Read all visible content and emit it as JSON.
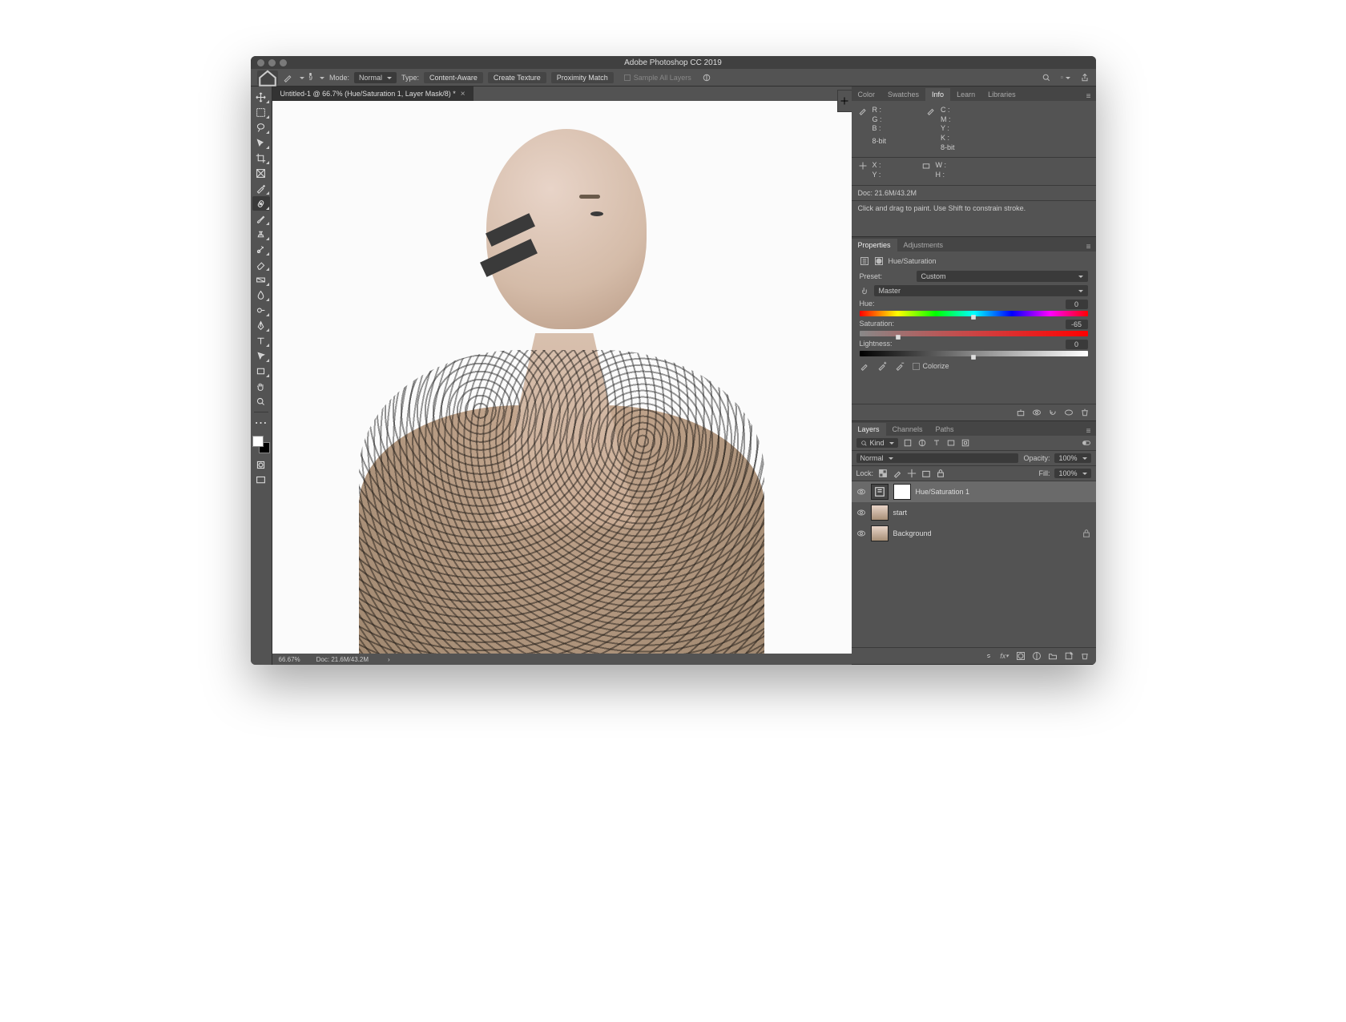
{
  "title": "Adobe Photoshop CC 2019",
  "optionbar": {
    "brush_size": "9",
    "mode_label": "Mode:",
    "mode_value": "Normal",
    "type_label": "Type:",
    "btn_content_aware": "Content-Aware",
    "btn_create_texture": "Create Texture",
    "btn_proximity": "Proximity Match",
    "sample_all": "Sample All Layers"
  },
  "doc_tab": "Untitled-1 @ 66.7% (Hue/Saturation 1, Layer Mask/8) *",
  "status": {
    "zoom": "66.67%",
    "doc": "Doc: 21.6M/43.2M"
  },
  "info_panel": {
    "tabs": [
      "Color",
      "Swatches",
      "Info",
      "Learn",
      "Libraries"
    ],
    "rgb": {
      "r": "R :",
      "g": "G :",
      "b": "B :"
    },
    "cmyk": {
      "c": "C :",
      "m": "M :",
      "y": "Y :",
      "k": "K :"
    },
    "bit": "8-bit",
    "xy": {
      "x": "X :",
      "y": "Y :"
    },
    "wh": {
      "w": "W :",
      "h": "H :"
    },
    "doc": "Doc: 21.6M/43.2M",
    "hint": "Click and drag to paint. Use Shift to constrain stroke."
  },
  "prop_panel": {
    "tabs": [
      "Properties",
      "Adjustments"
    ],
    "adj_name": "Hue/Saturation",
    "preset_label": "Preset:",
    "preset_value": "Custom",
    "channel_value": "Master",
    "hue": {
      "label": "Hue:",
      "value": "0",
      "pos": 50
    },
    "saturation": {
      "label": "Saturation:",
      "value": "-65",
      "pos": 17
    },
    "lightness": {
      "label": "Lightness:",
      "value": "0",
      "pos": 50
    },
    "colorize": "Colorize"
  },
  "layers_panel": {
    "tabs": [
      "Layers",
      "Channels",
      "Paths"
    ],
    "filter": "Kind",
    "blend": "Normal",
    "opacity_label": "Opacity:",
    "opacity_value": "100%",
    "lock_label": "Lock:",
    "fill_label": "Fill:",
    "fill_value": "100%",
    "layers": [
      {
        "name": "Hue/Saturation 1",
        "type": "adj",
        "selected": true,
        "visible": true
      },
      {
        "name": "start",
        "type": "img",
        "selected": false,
        "visible": true
      },
      {
        "name": "Background",
        "type": "img",
        "selected": false,
        "visible": true,
        "locked": true
      }
    ]
  }
}
